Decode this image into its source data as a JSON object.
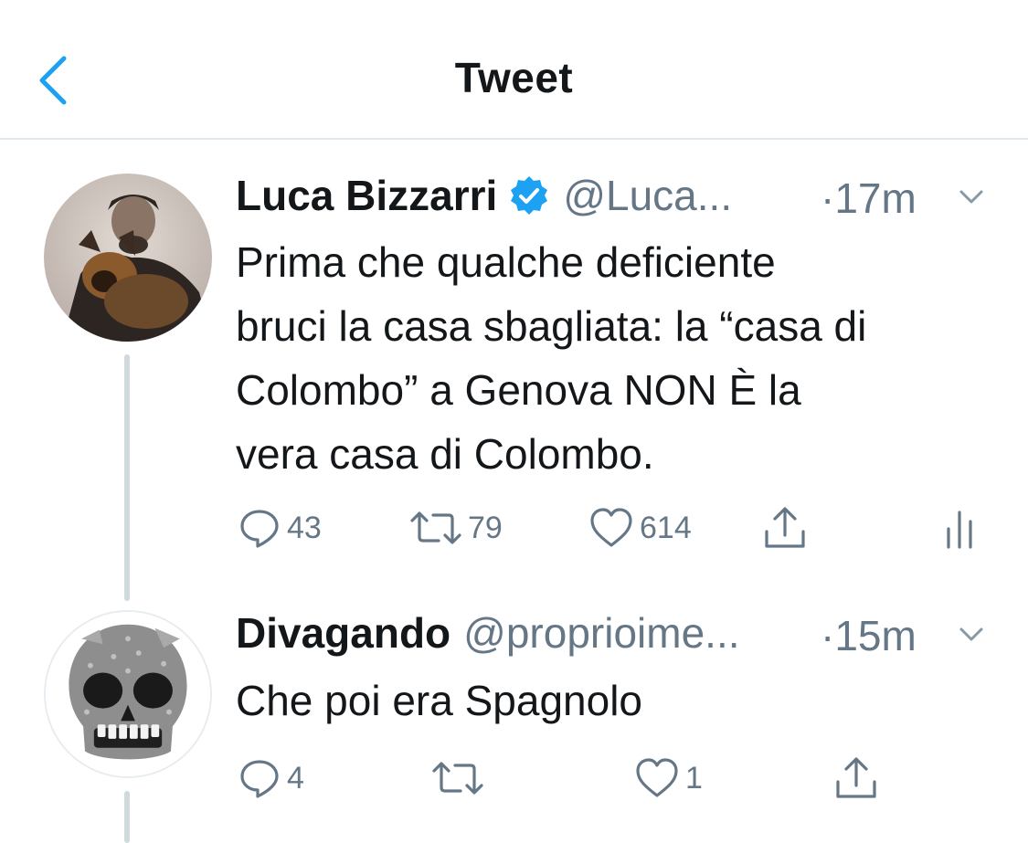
{
  "header": {
    "title": "Tweet"
  },
  "tweets": [
    {
      "name": "Luca Bizzarri",
      "verified": true,
      "handle": "@Luca...",
      "time": "·17m",
      "text_lines": [
        "Prima che qualche deficiente",
        "bruci la casa sbagliata: la “casa di",
        "Colombo” a Genova NON È la",
        "vera casa di Colombo."
      ],
      "replies": "43",
      "retweets": "79",
      "likes": "614"
    },
    {
      "name": "Divagando",
      "verified": false,
      "handle": "@proprioime...",
      "time": "·15m",
      "text_lines": [
        "Che poi era Spagnolo"
      ],
      "replies": "4",
      "retweets": "",
      "likes": "1"
    }
  ],
  "icons": {
    "back": "chevron-left-icon",
    "verified": "verified-badge-icon",
    "caret": "chevron-down-icon",
    "reply": "reply-icon",
    "retweet": "retweet-icon",
    "like": "heart-icon",
    "share": "share-icon",
    "analytics": "analytics-icon"
  },
  "colors": {
    "accent": "#1da1f2",
    "text": "#14171a",
    "secondary": "#657786",
    "divider": "#e1e8ed"
  }
}
